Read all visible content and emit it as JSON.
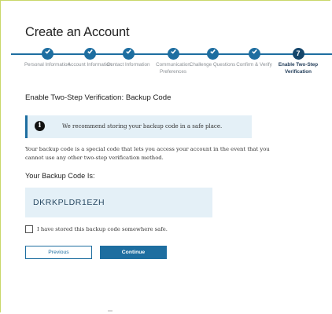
{
  "page": {
    "title": "Create an Account",
    "section_title": "Enable Two-Step Verification: Backup Code"
  },
  "steps": [
    {
      "label": "Personal Information",
      "state": "done"
    },
    {
      "label": "Account Information",
      "state": "done"
    },
    {
      "label": "Contact Information",
      "state": "done"
    },
    {
      "label": "Communication Preferences",
      "state": "done"
    },
    {
      "label": "Challenge Questions",
      "state": "done"
    },
    {
      "label": "Confirm & Verify",
      "state": "done"
    },
    {
      "label": "Enable Two-Step Verification",
      "state": "current",
      "number": "7"
    }
  ],
  "info": {
    "icon": "info-icon",
    "text": "We recommend storing your backup code in a safe place."
  },
  "description": "Your backup code is a special code that lets you access your account in the event that you cannot use any other two-step verification method.",
  "backup": {
    "label": "Your Backup Code Is:",
    "code": "DKRKPLDR1EZH"
  },
  "confirm": {
    "label": "I have stored this backup code somewhere safe.",
    "checked": false
  },
  "buttons": {
    "previous": "Previous",
    "continue": "Continue"
  },
  "colors": {
    "primary": "#1e6ea0",
    "info_bg": "#e4f0f7"
  }
}
